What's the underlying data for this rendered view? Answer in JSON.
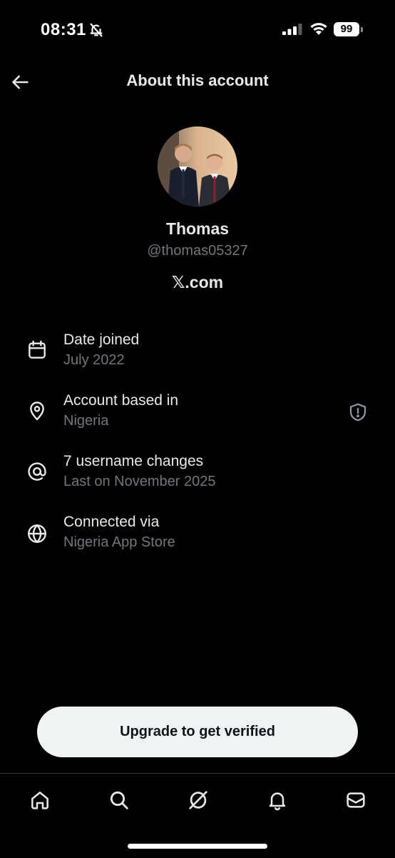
{
  "status_bar": {
    "time": "08:31",
    "battery_level": "99",
    "icons": [
      "bell-off-icon",
      "signal-icon",
      "wifi-icon",
      "battery-icon"
    ]
  },
  "header": {
    "title": "About this account",
    "back_icon": "arrow-left-icon"
  },
  "profile": {
    "display_name": "Thomas",
    "handle": "@thomas05327",
    "platform": "𝕏.com"
  },
  "info_items": [
    {
      "icon": "calendar-icon",
      "title": "Date joined",
      "subtitle": "July 2022"
    },
    {
      "icon": "location-pin-icon",
      "title": "Account based in",
      "subtitle": "Nigeria",
      "action_icon": "shield-alert-icon"
    },
    {
      "icon": "at-sign-icon",
      "title": "7 username changes",
      "subtitle": "Last on November 2025"
    },
    {
      "icon": "globe-icon",
      "title": "Connected via",
      "subtitle": "Nigeria App Store"
    }
  ],
  "upgrade_button": {
    "label": "Upgrade to get verified"
  },
  "bottom_nav": {
    "items": [
      "home-icon",
      "search-icon",
      "grok-icon",
      "notifications-icon",
      "messages-icon"
    ]
  },
  "colors": {
    "background": "#000000",
    "text_primary": "#e7e9ea",
    "text_secondary": "#71767b",
    "button_background": "#eff3f4"
  }
}
